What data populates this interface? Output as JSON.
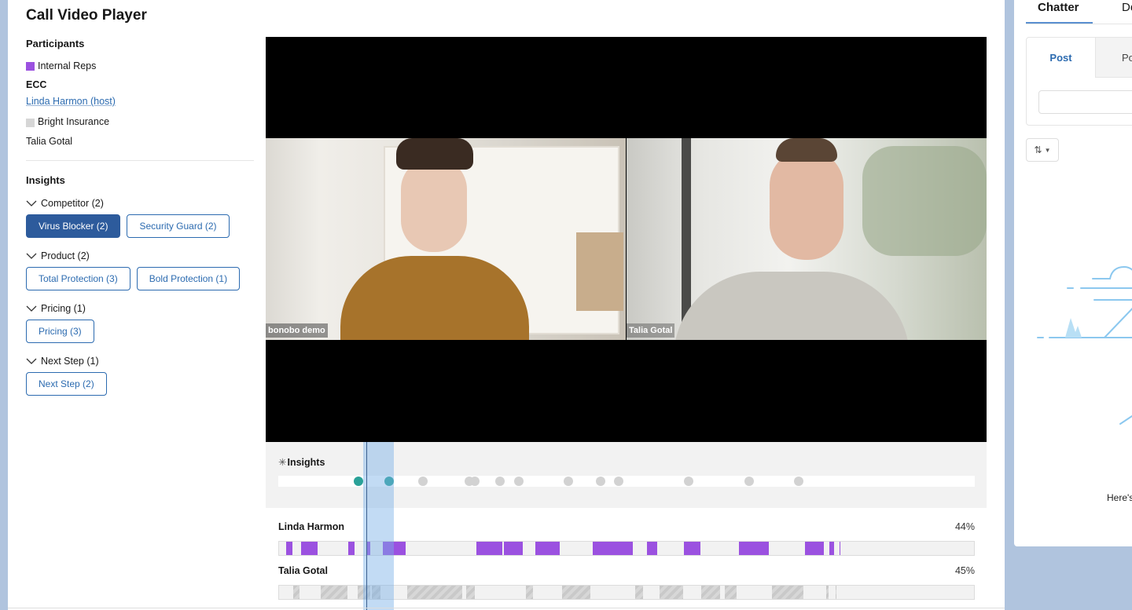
{
  "page_title": "Call Video Player",
  "participants": {
    "title": "Participants",
    "groups": [
      {
        "legend_label": "Internal Reps",
        "legend_color": "#9b51e0",
        "company": "ECC",
        "people": [
          {
            "name": "Linda Harmon (host)",
            "is_link": true
          }
        ]
      },
      {
        "legend_label": "Bright Insurance",
        "legend_color": "#d6d6d6",
        "people": [
          {
            "name": "Talia Gotal",
            "is_link": false
          }
        ]
      }
    ]
  },
  "insights": {
    "title": "Insights",
    "groups": [
      {
        "label": "Competitor (2)",
        "chips": [
          {
            "label": "Virus Blocker (2)",
            "active": true
          },
          {
            "label": "Security Guard (2)",
            "active": false
          }
        ]
      },
      {
        "label": "Product (2)",
        "chips": [
          {
            "label": "Total Protection (3)",
            "active": false
          },
          {
            "label": "Bold Protection (1)",
            "active": false
          }
        ]
      },
      {
        "label": "Pricing (1)",
        "chips": [
          {
            "label": "Pricing (3)",
            "active": false
          }
        ]
      },
      {
        "label": "Next Step (1)",
        "chips": [
          {
            "label": "Next Step (2)",
            "active": false
          }
        ]
      }
    ]
  },
  "video": {
    "tiles": [
      {
        "name_tag": "bonobo demo"
      },
      {
        "name_tag": "Talia Gotal"
      }
    ]
  },
  "timeline": {
    "insights_label": "Insights",
    "insight_markers": [
      {
        "pos": 0.115,
        "active": true
      },
      {
        "pos": 0.159,
        "active": true
      },
      {
        "pos": 0.208,
        "active": false
      },
      {
        "pos": 0.274,
        "active": false
      },
      {
        "pos": 0.282,
        "active": false
      },
      {
        "pos": 0.318,
        "active": false
      },
      {
        "pos": 0.345,
        "active": false
      },
      {
        "pos": 0.416,
        "active": false
      },
      {
        "pos": 0.463,
        "active": false
      },
      {
        "pos": 0.489,
        "active": false
      },
      {
        "pos": 0.589,
        "active": false
      },
      {
        "pos": 0.676,
        "active": false
      },
      {
        "pos": 0.747,
        "active": false
      }
    ],
    "selection": {
      "start": 0.122,
      "end": 0.166
    },
    "playhead": 0.126,
    "speakers": [
      {
        "name": "Linda Harmon",
        "talk_percent": "44%",
        "color": "purple",
        "segments": [
          [
            0.01,
            0.019
          ],
          [
            0.032,
            0.056
          ],
          [
            0.1,
            0.109
          ],
          [
            0.125,
            0.131
          ],
          [
            0.149,
            0.182
          ],
          [
            0.284,
            0.321
          ],
          [
            0.324,
            0.351
          ],
          [
            0.369,
            0.404
          ],
          [
            0.451,
            0.509
          ],
          [
            0.529,
            0.544
          ],
          [
            0.583,
            0.606
          ],
          [
            0.662,
            0.705
          ],
          [
            0.757,
            0.784
          ],
          [
            0.792,
            0.799
          ],
          [
            0.806,
            0.808
          ]
        ]
      },
      {
        "name": "Talia Gotal",
        "talk_percent": "45%",
        "color": "gray",
        "segments": [
          [
            0.02,
            0.029
          ],
          [
            0.06,
            0.098
          ],
          [
            0.113,
            0.131
          ],
          [
            0.133,
            0.146
          ],
          [
            0.184,
            0.264
          ],
          [
            0.269,
            0.282
          ],
          [
            0.355,
            0.365
          ],
          [
            0.407,
            0.448
          ],
          [
            0.513,
            0.524
          ],
          [
            0.547,
            0.581
          ],
          [
            0.608,
            0.635
          ],
          [
            0.641,
            0.658
          ],
          [
            0.709,
            0.755
          ],
          [
            0.787,
            0.791
          ],
          [
            0.801,
            0.802
          ]
        ]
      }
    ]
  },
  "right_panel": {
    "tabs": [
      {
        "label": "Chatter",
        "active": true
      },
      {
        "label": "De",
        "active": false
      }
    ],
    "publisher_tabs": [
      {
        "label": "Post",
        "active": true
      },
      {
        "label": "Po",
        "active": false
      }
    ],
    "sort_icon": "sort-arrows-icon",
    "empty_text": "Here's"
  }
}
